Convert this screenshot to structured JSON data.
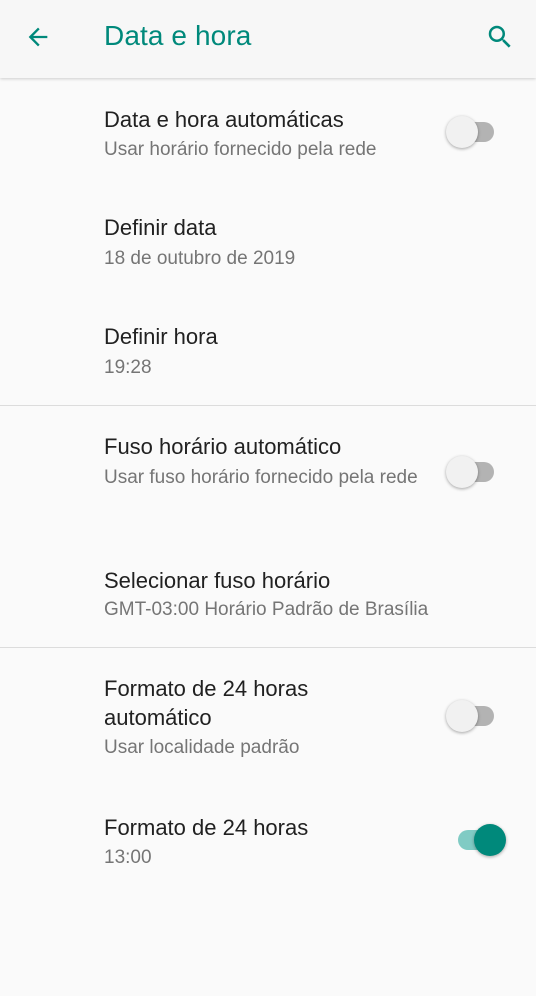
{
  "header": {
    "title": "Data e hora",
    "back_icon": "arrow-back-icon",
    "search_icon": "search-icon",
    "accent_color": "#00897b"
  },
  "settings": {
    "auto_datetime": {
      "title": "Data e hora automáticas",
      "summary": "Usar horário fornecido pela rede",
      "enabled": false
    },
    "set_date": {
      "title": "Definir data",
      "summary": "18 de outubro de 2019"
    },
    "set_time": {
      "title": "Definir hora",
      "summary": "19:28"
    },
    "auto_timezone": {
      "title": "Fuso horário automático",
      "summary": "Usar fuso horário fornecido pela rede",
      "enabled": false
    },
    "select_timezone": {
      "title": "Selecionar fuso horário",
      "summary": "GMT-03:00 Horário Padrão de Brasília"
    },
    "auto_24h": {
      "title_line1": "Formato de 24 horas",
      "title_line2": "automático",
      "summary": "Usar localidade padrão",
      "enabled": false
    },
    "use_24h": {
      "title": "Formato de 24 horas",
      "summary": "13:00",
      "enabled": true
    }
  }
}
